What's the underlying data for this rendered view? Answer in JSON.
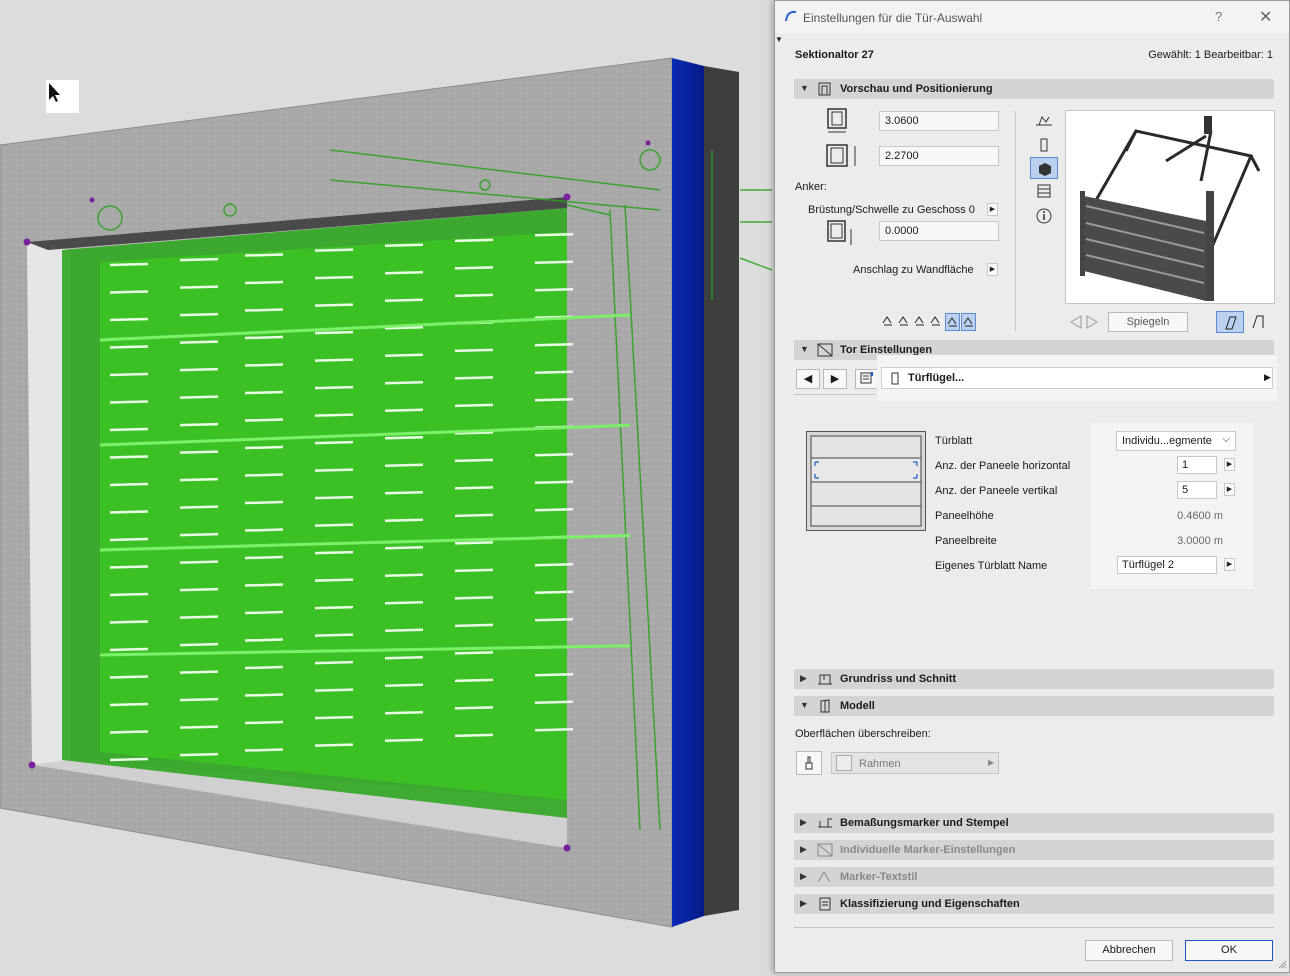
{
  "dialog": {
    "title": "Einstellungen für die Tür-Auswahl",
    "help_label": "?",
    "close_label": "✕",
    "object_name": "Sektionaltor 27",
    "selection_info": "Gewählt: 1 Bearbeitbar: 1"
  },
  "preview_section": {
    "label": "Vorschau und Positionierung",
    "width_value": "3.0600",
    "height_value": "2.2700",
    "anchor_label": "Anker:",
    "sill_label": "Brüstung/Schwelle zu Geschoss 0",
    "sill_value": "0.0000",
    "wall_label": "Anschlag zu Wandfläche",
    "mirror_label": "Spiegeln"
  },
  "gate_section": {
    "label": "Tor Einstellungen",
    "page_label": "Türflügel...",
    "rows": [
      {
        "label": "Türblatt",
        "value": "Individu...egmente"
      },
      {
        "label": "Anz. der Paneele horizontal",
        "value": "1"
      },
      {
        "label": "Anz. der Paneele vertikal",
        "value": "5"
      },
      {
        "label": "Paneelhöhe",
        "value": "0.4600 m"
      },
      {
        "label": "Paneelbreite",
        "value": "3.0000 m"
      },
      {
        "label": "Eigenes Türblatt Name",
        "value": "Türflügel 2"
      }
    ]
  },
  "sections": {
    "grundriss": "Grundriss und Schnitt",
    "modell": "Modell",
    "bemassung": "Bemaßungsmarker und Stempel",
    "individuell": "Individuelle Marker-Einstellungen",
    "marker_text": "Marker-Textstil",
    "klassifizierung": "Klassifizierung und Eigenschaften"
  },
  "model_section": {
    "override_label": "Oberflächen überschreiben:",
    "surface_label": "Rahmen"
  },
  "footer": {
    "cancel_label": "Abbrechen",
    "ok_label": "OK"
  },
  "colors": {
    "accent": "#1c58c8",
    "gate_green": "#33c21e",
    "wall_blue": "#0a23a8"
  },
  "icons": {
    "sill_buttons": [
      "anchor-bottom-icon",
      "anchor-top-icon",
      "anchor-side-icon",
      "anchor-edge-icon",
      "anchor-center-icon",
      "anchor-reveal-icon"
    ]
  }
}
